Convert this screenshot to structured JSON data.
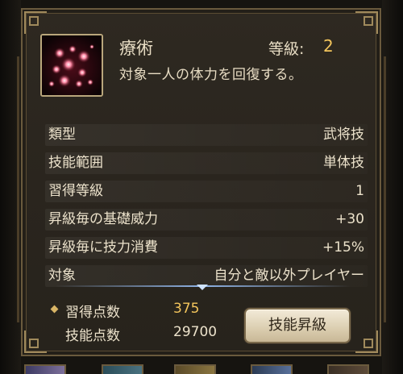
{
  "skill": {
    "name": "療術",
    "level_label": "等級:",
    "level_value": "2",
    "description": "対象一人の体力を回復する。",
    "icon": "red-sparkles-icon"
  },
  "stats": [
    {
      "label": "類型",
      "value": "武将技"
    },
    {
      "label": "技能範囲",
      "value": "単体技"
    },
    {
      "label": "習得等級",
      "value": "1"
    },
    {
      "label": "昇級毎の基礎威力",
      "value": "+30"
    },
    {
      "label": "昇級毎に技力消費",
      "value": "+15%"
    },
    {
      "label": "対象",
      "value": "自分と敵以外プレイヤー"
    }
  ],
  "points": {
    "acquire_label": "習得点数",
    "acquire_value": "375",
    "skill_points_label": "技能点数",
    "skill_points_value": "29700"
  },
  "upgrade_button": "技能昇級",
  "colors": {
    "panel_bg": "#2b261f",
    "border_gold": "#a08a5c",
    "text": "#ece2cb",
    "highlight": "#f3c55c",
    "divider_blue": "#8fb3e6"
  }
}
